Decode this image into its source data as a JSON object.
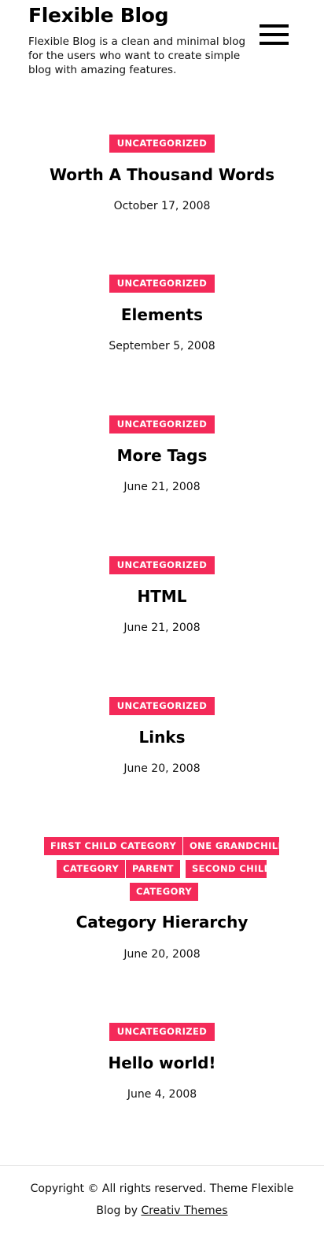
{
  "site": {
    "title": "Flexible Blog",
    "description": "Flexible Blog is a clean and minimal blog for the users who want to create simple blog with amazing features."
  },
  "colors": {
    "accent": "#f42a59",
    "text": "#000000",
    "background": "#ffffff"
  },
  "icons": {
    "menu": "hamburger-menu-icon"
  },
  "posts": [
    {
      "categories": [
        "UNCATEGORIZED"
      ],
      "title": "Worth A Thousand Words",
      "date": "October 17, 2008"
    },
    {
      "categories": [
        "UNCATEGORIZED"
      ],
      "title": "Elements",
      "date": "September 5, 2008"
    },
    {
      "categories": [
        "UNCATEGORIZED"
      ],
      "title": "More Tags",
      "date": "June 21, 2008"
    },
    {
      "categories": [
        "UNCATEGORIZED"
      ],
      "title": "HTML",
      "date": "June 21, 2008"
    },
    {
      "categories": [
        "UNCATEGORIZED"
      ],
      "title": "Links",
      "date": "June 20, 2008"
    },
    {
      "categories": [
        "FIRST CHILD CATEGORY",
        "ONE GRANDCHILD",
        "CATEGORY",
        "PARENT",
        "SECOND CHILD",
        "CATEGORY"
      ],
      "title": "Category Hierarchy",
      "date": "June 20, 2008"
    },
    {
      "categories": [
        "UNCATEGORIZED"
      ],
      "title": "Hello world!",
      "date": "June 4, 2008"
    }
  ],
  "footer": {
    "text": "Copyright © All rights reserved. Theme Flexible Blog by ",
    "link_text": "Creativ Themes"
  }
}
